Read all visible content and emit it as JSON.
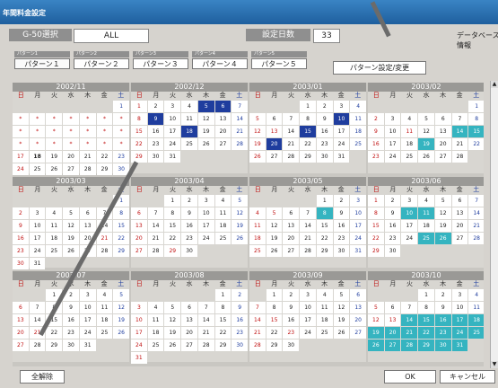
{
  "window_title": "年間料金設定",
  "header": {
    "group_label": "G-50選択",
    "group_value": "ALL",
    "days_label": "設定日数",
    "days_value": "33",
    "database_label": "データベース情報"
  },
  "patterns": [
    {
      "head": "パターン1",
      "label": "パターン１"
    },
    {
      "head": "パターン2",
      "label": "パターン２"
    },
    {
      "head": "パターン3",
      "label": "パターン３"
    },
    {
      "head": "パターン4",
      "label": "パターン４"
    },
    {
      "head": "パターン5",
      "label": "パターン５"
    }
  ],
  "pattern_setting_button": "パターン設定/変更",
  "weekdays": [
    "日",
    "月",
    "火",
    "水",
    "木",
    "金",
    "土"
  ],
  "months": [
    {
      "title": "2002/11",
      "weeks": [
        [
          "",
          "",
          "",
          "",
          "",
          "",
          "1"
        ],
        [
          "*",
          "*",
          "*",
          "*",
          "*",
          "*",
          "*"
        ],
        [
          "*",
          "*",
          "*",
          "*",
          "*",
          "*",
          "*"
        ],
        [
          "*",
          "*",
          "*",
          "*",
          "*",
          "*",
          "*"
        ],
        [
          "17",
          "18",
          "19",
          "20",
          "21",
          "22",
          "23"
        ],
        [
          "24",
          "25",
          "26",
          "27",
          "28",
          "29",
          "30"
        ]
      ],
      "pattern_days": [],
      "green_days": [],
      "bold_days": [
        "18"
      ]
    },
    {
      "title": "2002/12",
      "weeks": [
        [
          "1",
          "2",
          "3",
          "4",
          "5",
          "6",
          "7"
        ],
        [
          "8",
          "9",
          "10",
          "11",
          "12",
          "13",
          "14"
        ],
        [
          "15",
          "16",
          "17",
          "18",
          "19",
          "20",
          "21"
        ],
        [
          "22",
          "23",
          "24",
          "25",
          "26",
          "27",
          "28"
        ],
        [
          "29",
          "30",
          "31",
          "",
          "",
          "",
          ""
        ],
        [
          "",
          "",
          "",
          "",
          "",
          "",
          ""
        ]
      ],
      "pattern_days": [
        "5",
        "6",
        "9",
        "18"
      ],
      "green_days": [],
      "bold_days": []
    },
    {
      "title": "2003/01",
      "weeks": [
        [
          "",
          "",
          "",
          "1",
          "2",
          "3",
          "4"
        ],
        [
          "5",
          "6",
          "7",
          "8",
          "9",
          "10",
          "11"
        ],
        [
          "12",
          "13",
          "14",
          "15",
          "16",
          "17",
          "18"
        ],
        [
          "19",
          "20",
          "21",
          "22",
          "23",
          "24",
          "25"
        ],
        [
          "26",
          "27",
          "28",
          "29",
          "30",
          "31",
          ""
        ],
        [
          "",
          "",
          "",
          "",
          "",
          "",
          ""
        ]
      ],
      "pattern_days": [
        "10",
        "15",
        "20"
      ],
      "green_days": [],
      "bold_days": []
    },
    {
      "title": "2003/02",
      "weeks": [
        [
          "",
          "",
          "",
          "",
          "",
          "",
          "1"
        ],
        [
          "2",
          "3",
          "4",
          "5",
          "6",
          "7",
          "8"
        ],
        [
          "9",
          "10",
          "11",
          "12",
          "13",
          "14",
          "15"
        ],
        [
          "16",
          "17",
          "18",
          "19",
          "20",
          "21",
          "22"
        ],
        [
          "23",
          "24",
          "25",
          "26",
          "27",
          "28",
          ""
        ],
        [
          "",
          "",
          "",
          "",
          "",
          "",
          ""
        ]
      ],
      "pattern_days": [],
      "green_days": [
        "14",
        "15",
        "19"
      ],
      "bold_days": []
    },
    {
      "title": "2003/03",
      "weeks": [
        [
          "",
          "",
          "",
          "",
          "",
          "",
          "1"
        ],
        [
          "2",
          "3",
          "4",
          "5",
          "6",
          "7",
          "8"
        ],
        [
          "9",
          "10",
          "11",
          "12",
          "13",
          "14",
          "15"
        ],
        [
          "16",
          "17",
          "18",
          "19",
          "20",
          "21",
          "22"
        ],
        [
          "23",
          "24",
          "25",
          "26",
          "27",
          "28",
          "29"
        ],
        [
          "30",
          "31",
          "",
          "",
          "",
          "",
          ""
        ]
      ],
      "pattern_days": [],
      "green_days": [],
      "bold_days": []
    },
    {
      "title": "2003/04",
      "weeks": [
        [
          "",
          "",
          "1",
          "2",
          "3",
          "4",
          "5"
        ],
        [
          "6",
          "7",
          "8",
          "9",
          "10",
          "11",
          "12"
        ],
        [
          "13",
          "14",
          "15",
          "16",
          "17",
          "18",
          "19"
        ],
        [
          "20",
          "21",
          "22",
          "23",
          "24",
          "25",
          "26"
        ],
        [
          "27",
          "28",
          "29",
          "30",
          "",
          "",
          ""
        ],
        [
          "",
          "",
          "",
          "",
          "",
          "",
          ""
        ]
      ],
      "pattern_days": [],
      "green_days": [],
      "bold_days": []
    },
    {
      "title": "2003/05",
      "weeks": [
        [
          "",
          "",
          "",
          "",
          "1",
          "2",
          "3"
        ],
        [
          "4",
          "5",
          "6",
          "7",
          "8",
          "9",
          "10"
        ],
        [
          "11",
          "12",
          "13",
          "14",
          "15",
          "16",
          "17"
        ],
        [
          "18",
          "19",
          "20",
          "21",
          "22",
          "23",
          "24"
        ],
        [
          "25",
          "26",
          "27",
          "28",
          "29",
          "30",
          "31"
        ],
        [
          "",
          "",
          "",
          "",
          "",
          "",
          ""
        ]
      ],
      "pattern_days": [],
      "green_days": [
        "8"
      ],
      "bold_days": []
    },
    {
      "title": "2003/06",
      "weeks": [
        [
          "1",
          "2",
          "3",
          "4",
          "5",
          "6",
          "7"
        ],
        [
          "8",
          "9",
          "10",
          "11",
          "12",
          "13",
          "14"
        ],
        [
          "15",
          "16",
          "17",
          "18",
          "19",
          "20",
          "21"
        ],
        [
          "22",
          "23",
          "24",
          "25",
          "26",
          "27",
          "28"
        ],
        [
          "29",
          "30",
          "",
          "",
          "",
          "",
          ""
        ],
        [
          "",
          "",
          "",
          "",
          "",
          "",
          ""
        ]
      ],
      "pattern_days": [],
      "green_days": [
        "10",
        "11",
        "25",
        "26"
      ],
      "bold_days": []
    },
    {
      "title": "2003/07",
      "weeks": [
        [
          "",
          "",
          "1",
          "2",
          "3",
          "4",
          "5"
        ],
        [
          "6",
          "7",
          "8",
          "9",
          "10",
          "11",
          "12"
        ],
        [
          "13",
          "14",
          "15",
          "16",
          "17",
          "18",
          "19"
        ],
        [
          "20",
          "21",
          "22",
          "23",
          "24",
          "25",
          "26"
        ],
        [
          "27",
          "28",
          "29",
          "30",
          "31",
          "",
          ""
        ],
        [
          "",
          "",
          "",
          "",
          "",
          "",
          ""
        ]
      ],
      "pattern_days": [],
      "green_days": [],
      "bold_days": []
    },
    {
      "title": "2003/08",
      "weeks": [
        [
          "",
          "",
          "",
          "",
          "",
          "1",
          "2"
        ],
        [
          "3",
          "4",
          "5",
          "6",
          "7",
          "8",
          "9"
        ],
        [
          "10",
          "11",
          "12",
          "13",
          "14",
          "15",
          "16"
        ],
        [
          "17",
          "18",
          "19",
          "20",
          "21",
          "22",
          "23"
        ],
        [
          "24",
          "25",
          "26",
          "27",
          "28",
          "29",
          "30"
        ],
        [
          "31",
          "",
          "",
          "",
          "",
          "",
          ""
        ]
      ],
      "pattern_days": [],
      "green_days": [],
      "bold_days": []
    },
    {
      "title": "2003/09",
      "weeks": [
        [
          "",
          "1",
          "2",
          "3",
          "4",
          "5",
          "6"
        ],
        [
          "7",
          "8",
          "9",
          "10",
          "11",
          "12",
          "13"
        ],
        [
          "14",
          "15",
          "16",
          "17",
          "18",
          "19",
          "20"
        ],
        [
          "21",
          "22",
          "23",
          "24",
          "25",
          "26",
          "27"
        ],
        [
          "28",
          "29",
          "30",
          "",
          "",
          "",
          ""
        ],
        [
          "",
          "",
          "",
          "",
          "",
          "",
          ""
        ]
      ],
      "pattern_days": [],
      "green_days": [],
      "bold_days": []
    },
    {
      "title": "2003/10",
      "weeks": [
        [
          "",
          "",
          "",
          "1",
          "2",
          "3",
          "4"
        ],
        [
          "5",
          "6",
          "7",
          "8",
          "9",
          "10",
          "11"
        ],
        [
          "12",
          "13",
          "14",
          "15",
          "16",
          "17",
          "18"
        ],
        [
          "19",
          "20",
          "21",
          "22",
          "23",
          "24",
          "25"
        ],
        [
          "26",
          "27",
          "28",
          "29",
          "30",
          "31",
          ""
        ],
        [
          "",
          "",
          "",
          "",
          "",
          "",
          ""
        ]
      ],
      "pattern_days": [],
      "green_days": [
        "14",
        "15",
        "16",
        "17",
        "18",
        "19",
        "20",
        "21",
        "22",
        "23",
        "24",
        "25",
        "26",
        "27",
        "28",
        "29",
        "30",
        "31"
      ],
      "bold_days": []
    }
  ],
  "holidays": {
    "2002/11": [
      "23"
    ],
    "2002/12": [],
    "2003/01": [
      "13"
    ],
    "2003/02": [
      "11"
    ],
    "2003/03": [
      "21"
    ],
    "2003/04": [
      "29"
    ],
    "2003/05": [
      "5"
    ],
    "2003/06": [],
    "2003/07": [
      "21"
    ],
    "2003/08": [],
    "2003/09": [
      "15",
      "23"
    ],
    "2003/10": [
      "13"
    ]
  },
  "footer": {
    "clear_all": "全解除",
    "ok": "OK",
    "cancel": "キャンセル"
  }
}
